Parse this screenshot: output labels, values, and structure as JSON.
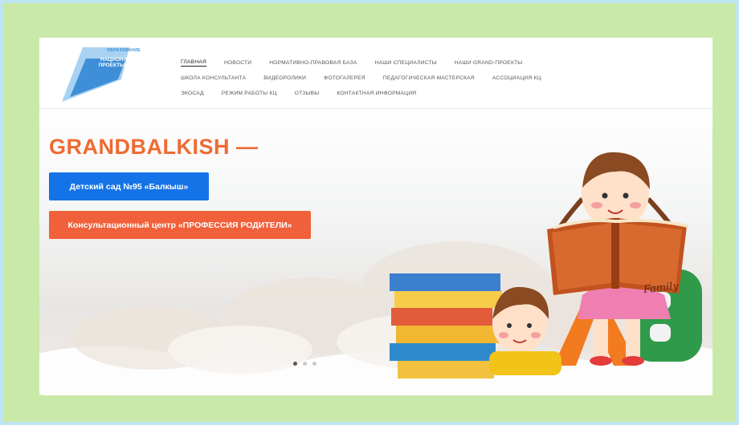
{
  "logo": {
    "line1": "ОБРАЗОВАНИЕ",
    "line2": "НАЦИОНАЛЬНЫЕ ПРОЕКТЫ РОССИИ",
    "colors": {
      "light": "#a9d2f2",
      "dark": "#3f8fd8"
    }
  },
  "nav": {
    "rows": [
      [
        {
          "label": "ГЛАВНАЯ",
          "active": true
        },
        {
          "label": "НОВОСТИ"
        },
        {
          "label": "НОРМАТИВНО-ПРАВОВАЯ БАЗА"
        },
        {
          "label": "НАШИ СПЕЦИАЛИСТЫ"
        },
        {
          "label": "НАШИ GRAND-ПРОЕКТЫ"
        }
      ],
      [
        {
          "label": "ШКОЛА КОНСУЛЬТАНТА"
        },
        {
          "label": "ВИДЕОРОЛИКИ"
        },
        {
          "label": "ФОТОГАЛЕРЕЯ"
        },
        {
          "label": "ПЕДАГОГИЧЕСКАЯ МАСТЕРСКАЯ"
        },
        {
          "label": "АССОЦИАЦИЯ КЦ"
        }
      ],
      [
        {
          "label": "ЭКОСАД"
        },
        {
          "label": "РЕЖИМ РАБОТЫ КЦ"
        },
        {
          "label": "ОТЗЫВЫ"
        },
        {
          "label": "КОНТАКТНАЯ ИНФОРМАЦИЯ"
        }
      ]
    ]
  },
  "hero": {
    "title": "GRANDBALKISH —",
    "button_primary": "Детский сад №95 «Балкыш»",
    "button_secondary": "Консультационный центр «ПРОФЕССИЯ РОДИТЕЛИ»",
    "book_title": "Family",
    "slides": {
      "count": 3,
      "active": 0
    }
  },
  "colors": {
    "frame_green": "#c9e9a8",
    "accent_orange": "#f06a32",
    "primary_blue": "#1473e6",
    "secondary_orange": "#f0603a"
  }
}
